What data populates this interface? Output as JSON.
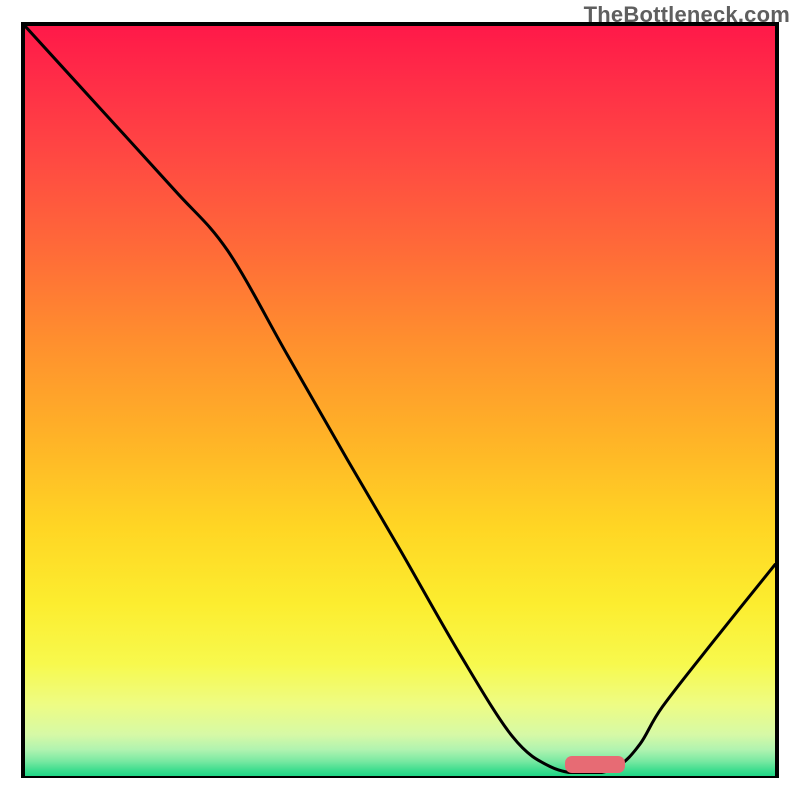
{
  "watermark": "TheBottleneck.com",
  "chart_data": {
    "type": "line",
    "title": "",
    "xlabel": "",
    "ylabel": "",
    "xlim": [
      0,
      100
    ],
    "ylim": [
      0,
      100
    ],
    "series": [
      {
        "name": "bottleneck-curve",
        "x": [
          0,
          10,
          20,
          27,
          35,
          43,
          50,
          58,
          65,
          70,
          75,
          79,
          82,
          85,
          92,
          100
        ],
        "y": [
          100,
          89,
          78,
          70,
          56,
          42,
          30,
          16,
          5,
          1,
          0,
          1,
          4,
          9,
          18,
          28
        ]
      }
    ],
    "gradient_stops": [
      {
        "pos": 0.0,
        "color": "#ff1949"
      },
      {
        "pos": 0.08,
        "color": "#ff2f47"
      },
      {
        "pos": 0.18,
        "color": "#ff4a42"
      },
      {
        "pos": 0.3,
        "color": "#ff6b38"
      },
      {
        "pos": 0.42,
        "color": "#ff8f2e"
      },
      {
        "pos": 0.55,
        "color": "#ffb327"
      },
      {
        "pos": 0.67,
        "color": "#ffd624"
      },
      {
        "pos": 0.77,
        "color": "#fced2f"
      },
      {
        "pos": 0.85,
        "color": "#f7f94d"
      },
      {
        "pos": 0.905,
        "color": "#eefc84"
      },
      {
        "pos": 0.945,
        "color": "#d6f9a6"
      },
      {
        "pos": 0.965,
        "color": "#b0f3b0"
      },
      {
        "pos": 0.98,
        "color": "#7ae9a2"
      },
      {
        "pos": 0.992,
        "color": "#3fdd8f"
      },
      {
        "pos": 1.0,
        "color": "#1fd686"
      }
    ],
    "marker": {
      "x": 76,
      "y": 1.3,
      "w": 8,
      "h": 2.2,
      "color": "#e76b74"
    }
  }
}
